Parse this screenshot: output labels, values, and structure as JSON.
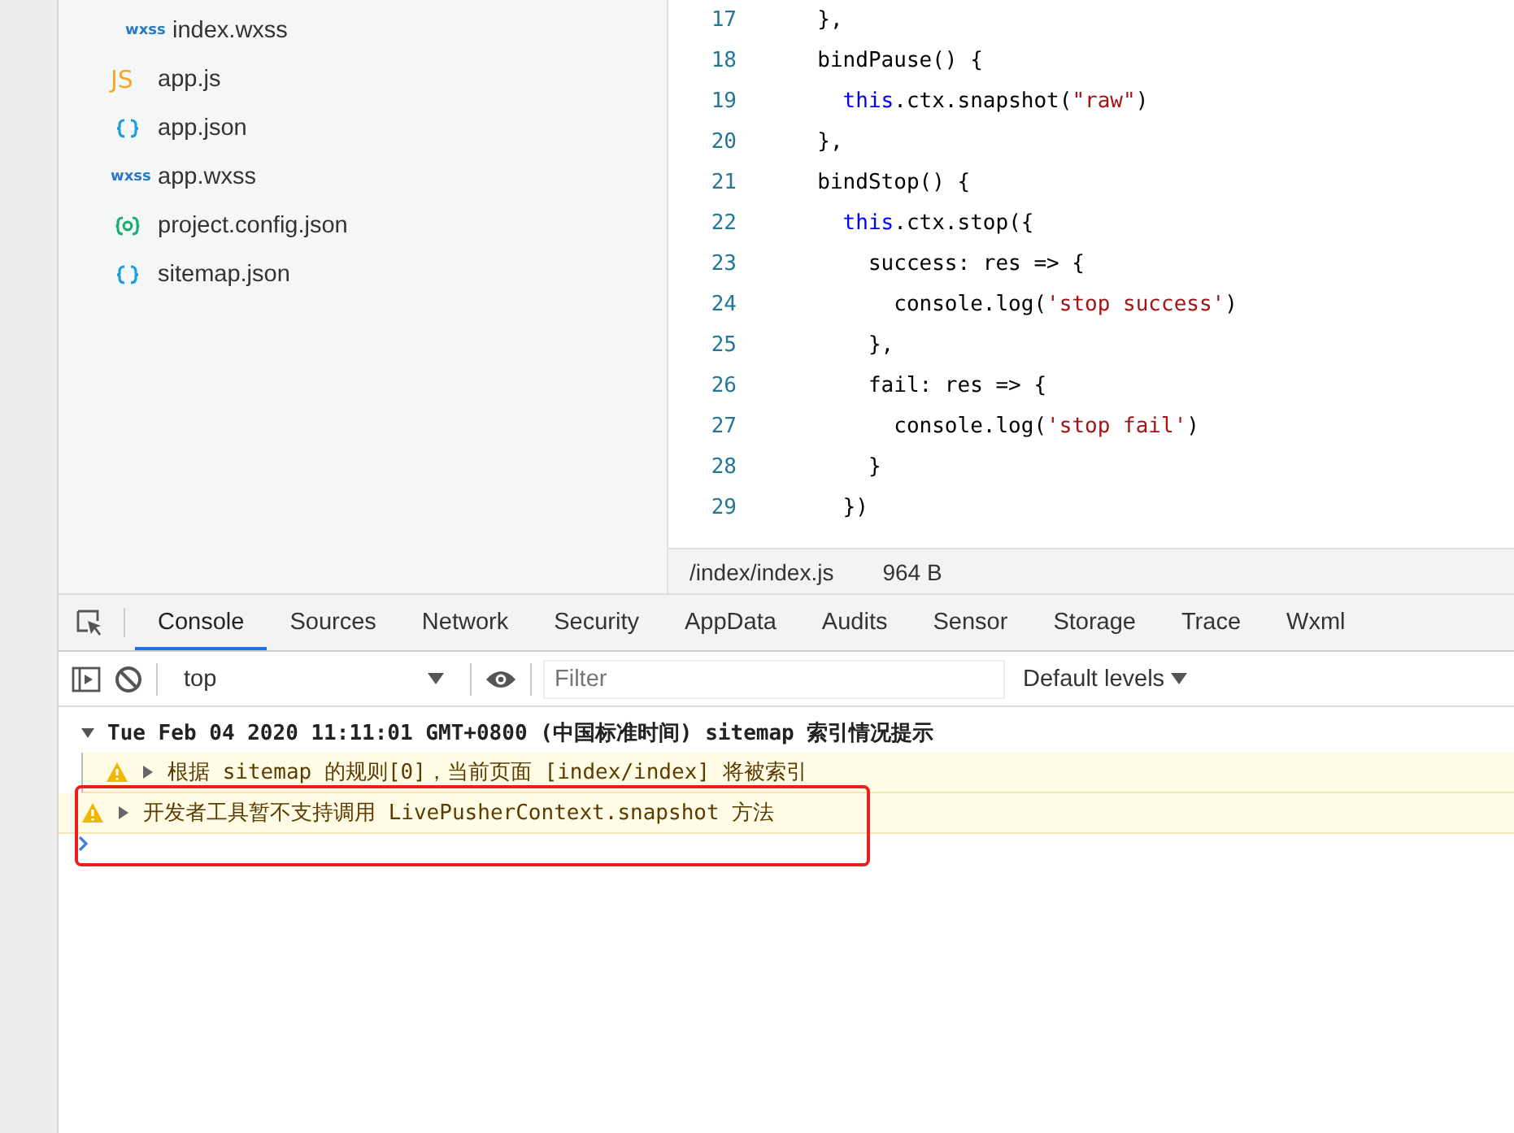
{
  "file_tree": {
    "items": [
      {
        "name": "index.wxss",
        "kind": "style",
        "badge": "wxss",
        "nested": true
      },
      {
        "name": "app.js",
        "kind": "script",
        "badge": "JS",
        "nested": false
      },
      {
        "name": "app.json",
        "kind": "data",
        "nested": false
      },
      {
        "name": "app.wxss",
        "kind": "style",
        "badge": "wxss",
        "nested": false
      },
      {
        "name": "project.config.json",
        "kind": "settings",
        "nested": false
      },
      {
        "name": "sitemap.json",
        "kind": "data",
        "nested": false
      }
    ]
  },
  "editor": {
    "lines": [
      {
        "number": "17",
        "tokens": [
          {
            "text": "  },",
            "kind": "plain"
          }
        ]
      },
      {
        "number": "18",
        "tokens": [
          {
            "text": "  bindPause() {",
            "kind": "plain"
          }
        ]
      },
      {
        "number": "19",
        "tokens": [
          {
            "text": "    this",
            "kind": "keyword"
          },
          {
            "text": ".ctx.snapshot(",
            "kind": "plain"
          },
          {
            "text": "\"raw\"",
            "kind": "string"
          },
          {
            "text": ")",
            "kind": "plain"
          }
        ]
      },
      {
        "number": "20",
        "tokens": [
          {
            "text": "  },",
            "kind": "plain"
          }
        ]
      },
      {
        "number": "21",
        "tokens": [
          {
            "text": "  bindStop() {",
            "kind": "plain"
          }
        ]
      },
      {
        "number": "22",
        "tokens": [
          {
            "text": "    this",
            "kind": "keyword"
          },
          {
            "text": ".ctx.stop({",
            "kind": "plain"
          }
        ]
      },
      {
        "number": "23",
        "tokens": [
          {
            "text": "      success: res => {",
            "kind": "plain"
          }
        ]
      },
      {
        "number": "24",
        "tokens": [
          {
            "text": "        console.log(",
            "kind": "plain"
          },
          {
            "text": "'stop success'",
            "kind": "string"
          },
          {
            "text": ")",
            "kind": "plain"
          }
        ]
      },
      {
        "number": "25",
        "tokens": [
          {
            "text": "      },",
            "kind": "plain"
          }
        ]
      },
      {
        "number": "26",
        "tokens": [
          {
            "text": "      fail: res => {",
            "kind": "plain"
          }
        ]
      },
      {
        "number": "27",
        "tokens": [
          {
            "text": "        console.log(",
            "kind": "plain"
          },
          {
            "text": "'stop fail'",
            "kind": "string"
          },
          {
            "text": ")",
            "kind": "plain"
          }
        ]
      },
      {
        "number": "28",
        "tokens": [
          {
            "text": "      }",
            "kind": "plain"
          }
        ]
      },
      {
        "number": "29",
        "tokens": [
          {
            "text": "    })",
            "kind": "plain"
          }
        ]
      }
    ],
    "status": {
      "path": "/index/index.js",
      "size": "964 B"
    }
  },
  "devtools": {
    "tabs": [
      {
        "label": "Console",
        "selected": true
      },
      {
        "label": "Sources",
        "selected": false
      },
      {
        "label": "Network",
        "selected": false
      },
      {
        "label": "Security",
        "selected": false
      },
      {
        "label": "AppData",
        "selected": false
      },
      {
        "label": "Audits",
        "selected": false
      },
      {
        "label": "Sensor",
        "selected": false
      },
      {
        "label": "Storage",
        "selected": false
      },
      {
        "label": "Trace",
        "selected": false
      },
      {
        "label": "Wxml",
        "selected": false
      }
    ],
    "context": "top",
    "filter": {
      "placeholder": "Filter"
    },
    "levels": "Default levels",
    "messages": [
      {
        "kind": "group",
        "text": "Tue Feb 04 2020 11:11:01 GMT+0800 (中国标准时间) sitemap 索引情况提示",
        "expanded": true,
        "children": [
          {
            "kind": "warning",
            "text": "根据 sitemap 的规则[0]，当前页面 [index/index] 将被索引"
          }
        ]
      },
      {
        "kind": "warning",
        "text": "开发者工具暂不支持调用 LivePusherContext.snapshot 方法"
      }
    ]
  }
}
